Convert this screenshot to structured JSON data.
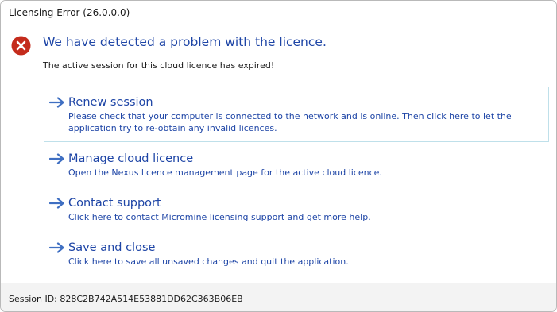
{
  "window": {
    "title": "Licensing Error (26.0.0.0)"
  },
  "main": {
    "icon": "error-x-icon",
    "heading": "We have detected a problem with the licence.",
    "subtext": "The active session for this cloud licence has expired!"
  },
  "options": [
    {
      "icon": "arrow-right-icon",
      "title": "Renew session",
      "description": "Please check that your computer is connected to the network and is online. Then click here to let the application try to re-obtain any invalid licences."
    },
    {
      "icon": "arrow-right-icon",
      "title": "Manage cloud licence",
      "description": "Open the Nexus licence management page for the active cloud licence."
    },
    {
      "icon": "arrow-right-icon",
      "title": "Contact support",
      "description": "Click here to contact Micromine licensing support and get more help."
    },
    {
      "icon": "arrow-right-icon",
      "title": "Save and close",
      "description": "Click here to save all unsaved changes and quit the application."
    }
  ],
  "footer": {
    "session": "Session ID: 828C2B742A514E53881DD62C363B06EB"
  },
  "colors": {
    "accent": "#1e45a6",
    "error": "#c42b1c",
    "arrow": "#3f6fc2",
    "focus_border": "#bfe0ea"
  }
}
